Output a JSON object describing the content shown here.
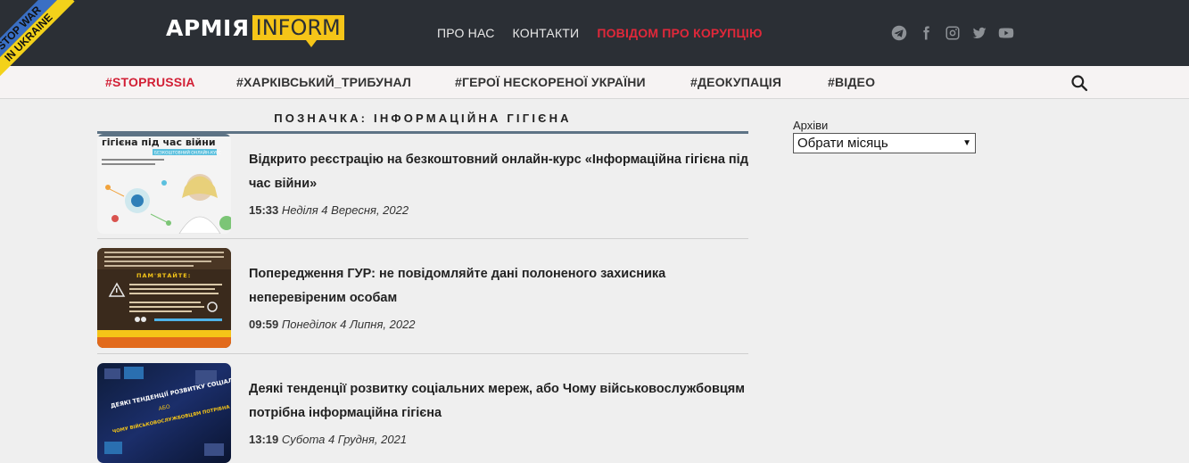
{
  "ribbon": {
    "line1": "STOP WAR",
    "line2": "IN UKRAINE"
  },
  "header": {
    "logo_part1": "АРМІЯ",
    "logo_part2": "INFORM",
    "nav": [
      {
        "label": "ПРО НАС"
      },
      {
        "label": "КОНТАКТИ"
      },
      {
        "label": "ПОВІДОМ ПРО КОРУПЦІЮ"
      }
    ],
    "socials": [
      "telegram-icon",
      "facebook-icon",
      "instagram-icon",
      "twitter-icon",
      "youtube-icon"
    ]
  },
  "tags": [
    {
      "label": "#STOPRUSSIA"
    },
    {
      "label": "#ХАРКІВСЬКИЙ_ТРИБУНАЛ"
    },
    {
      "label": "#ГЕРОЇ НЕСКОРЕНОЇ УКРАЇНИ"
    },
    {
      "label": "#ДЕОКУПАЦІЯ"
    },
    {
      "label": "#ВІДЕО"
    }
  ],
  "page": {
    "heading": "ПОЗНАЧКА: ІНФОРМАЦІЙНА ГІГІЄНА"
  },
  "posts": [
    {
      "title": "Відкрито реєстрацію на безкоштовний онлайн-курс «Інформаційна гігієна під час війни»",
      "time": "15:33",
      "date": "Неділя 4 Вересня, 2022",
      "thumb_text": "гігієна під час війни",
      "thumb_sub": "БЕЗКОШТОВНИЙ ОНЛАЙН-КУРС"
    },
    {
      "title": "Попередження ГУР: не повідомляйте дані полоненого захисника неперевіреним особам",
      "time": "09:59",
      "date": "Понеділок 4 Липня, 2022",
      "thumb_text": "ПАМ'ЯТАЙТЕ:"
    },
    {
      "title": "Деякі тенденції розвитку соціальних мереж, або Чому військовослужбовцям потрібна інформаційна гігієна",
      "time": "13:19",
      "date": "Субота 4 Грудня, 2021",
      "thumb_text": "ДЕЯКІ ТЕНДЕНЦІЇ РОЗВИТКУ СОЦІАЛЬНИХ МЕРЕЖ",
      "thumb_sub": "АБО",
      "thumb_text2": "ЧОМУ ВІЙСЬКОВОСЛУЖБОВЦЯМ ПОТРІБНА ІНФОРМАЦІЙНА ГІГІЄНА"
    }
  ],
  "sidebar": {
    "archive_label": "Архіви",
    "archive_select": "Обрати місяць"
  },
  "colors": {
    "header_bg": "#2b2f35",
    "accent_red": "#e0283a",
    "logo_yellow": "#f5c518",
    "heading_rule": "#5d7385"
  }
}
